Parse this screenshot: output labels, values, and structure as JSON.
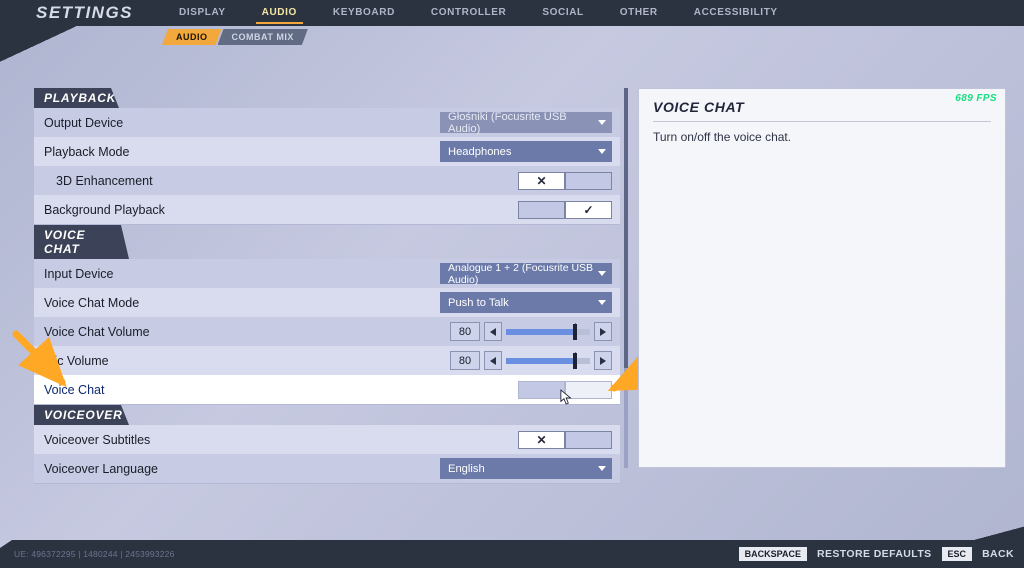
{
  "header": {
    "title": "SETTINGS",
    "tabs": [
      "DISPLAY",
      "AUDIO",
      "KEYBOARD",
      "CONTROLLER",
      "SOCIAL",
      "OTHER",
      "ACCESSIBILITY"
    ],
    "active_tab": "AUDIO",
    "subtabs": [
      "AUDIO",
      "COMBAT MIX"
    ],
    "active_subtab": "AUDIO"
  },
  "sections": {
    "playback": {
      "title": "PLAYBACK",
      "output_device": {
        "label": "Output Device",
        "value": "Głośniki (Focusrite USB Audio)"
      },
      "playback_mode": {
        "label": "Playback Mode",
        "value": "Headphones"
      },
      "enhancement_3d": {
        "label": "3D Enhancement",
        "value": false
      },
      "background_playback": {
        "label": "Background Playback",
        "value": true
      }
    },
    "voice_chat": {
      "title": "VOICE CHAT",
      "input_device": {
        "label": "Input Device",
        "value": "Analogue 1 + 2 (Focusrite USB Audio)"
      },
      "mode": {
        "label": "Voice Chat Mode",
        "value": "Push to Talk"
      },
      "volume": {
        "label": "Voice Chat Volume",
        "value": 80,
        "max": 100
      },
      "mic_volume": {
        "label": "Mic Volume",
        "value": 80,
        "max": 100
      },
      "voice_chat_toggle": {
        "label": "Voice Chat"
      }
    },
    "voiceover": {
      "title": "VOICEOVER",
      "subtitles": {
        "label": "Voiceover Subtitles",
        "value": false
      },
      "language": {
        "label": "Voiceover Language",
        "value": "English"
      }
    }
  },
  "right_panel": {
    "title": "VOICE CHAT",
    "desc": "Turn on/off the voice chat.",
    "fps": "689 FPS"
  },
  "footer": {
    "build": "UE: 496372295 | 1480244 | 2453993226",
    "restore_key": "BACKSPACE",
    "restore_label": "RESTORE DEFAULTS",
    "back_key": "ESC",
    "back_label": "BACK"
  }
}
